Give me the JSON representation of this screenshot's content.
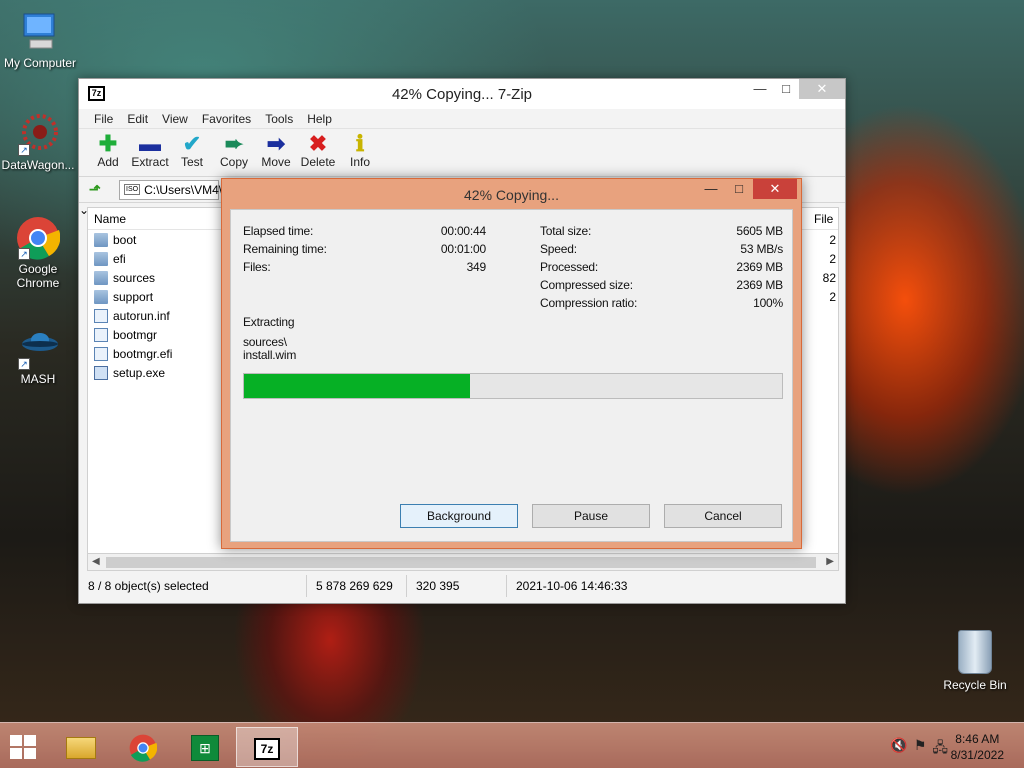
{
  "desktop": {
    "icons": [
      {
        "label": "My Computer"
      },
      {
        "label": "DataWagon..."
      },
      {
        "label": "Google Chrome"
      },
      {
        "label": "MASH"
      }
    ],
    "recycle_bin": "Recycle Bin"
  },
  "main_window": {
    "title": "42% Copying... 7-Zip",
    "app_icon": "7z",
    "menu": [
      "File",
      "Edit",
      "View",
      "Favorites",
      "Tools",
      "Help"
    ],
    "toolbar": [
      {
        "label": "Add",
        "icon": "plus-icon",
        "color": "#1fae3a"
      },
      {
        "label": "Extract",
        "icon": "minus-icon",
        "color": "#1b2f9e"
      },
      {
        "label": "Test",
        "icon": "check-icon",
        "color": "#22a7c9"
      },
      {
        "label": "Copy",
        "icon": "copy-arrow-icon",
        "color": "#1a8a5a"
      },
      {
        "label": "Move",
        "icon": "move-arrow-icon",
        "color": "#1b2f9e"
      },
      {
        "label": "Delete",
        "icon": "delete-x-icon",
        "color": "#d81e1e"
      },
      {
        "label": "Info",
        "icon": "info-icon",
        "color": "#c8b400"
      }
    ],
    "address": "C:\\Users\\VM4\\",
    "columns": {
      "name": "Name",
      "file": "File"
    },
    "files": [
      {
        "name": "boot",
        "type": "folder",
        "count": "2"
      },
      {
        "name": "efi",
        "type": "folder",
        "count": "2"
      },
      {
        "name": "sources",
        "type": "folder",
        "count": "82"
      },
      {
        "name": "support",
        "type": "folder",
        "count": "2"
      },
      {
        "name": "autorun.inf",
        "type": "file",
        "count": ""
      },
      {
        "name": "bootmgr",
        "type": "file",
        "count": ""
      },
      {
        "name": "bootmgr.efi",
        "type": "file",
        "count": ""
      },
      {
        "name": "setup.exe",
        "type": "exe",
        "count": ""
      }
    ],
    "status": {
      "selected": "8 / 8 object(s) selected",
      "size": "5 878 269 629",
      "packed": "320 395",
      "modified": "2021-10-06 14:46:33"
    }
  },
  "dialog": {
    "title": "42% Copying...",
    "left_stats": [
      {
        "label": "Elapsed time:",
        "value": "00:00:44"
      },
      {
        "label": "Remaining time:",
        "value": "00:01:00"
      },
      {
        "label": "Files:",
        "value": "349"
      }
    ],
    "right_stats": [
      {
        "label": "Total size:",
        "value": "5605 MB"
      },
      {
        "label": "Speed:",
        "value": "53 MB/s"
      },
      {
        "label": "Processed:",
        "value": "2369 MB"
      },
      {
        "label": "Compressed size:",
        "value": "2369 MB"
      },
      {
        "label": "Compression ratio:",
        "value": "100%"
      }
    ],
    "operation": "Extracting",
    "path_line1": "sources\\",
    "path_line2": "install.wim",
    "progress_fraction": 0.42,
    "progress_color": "#06b025",
    "buttons": {
      "background": "Background",
      "pause": "Pause",
      "cancel": "Cancel"
    }
  },
  "taskbar": {
    "time": "8:46 AM",
    "date": "8/31/2022"
  }
}
